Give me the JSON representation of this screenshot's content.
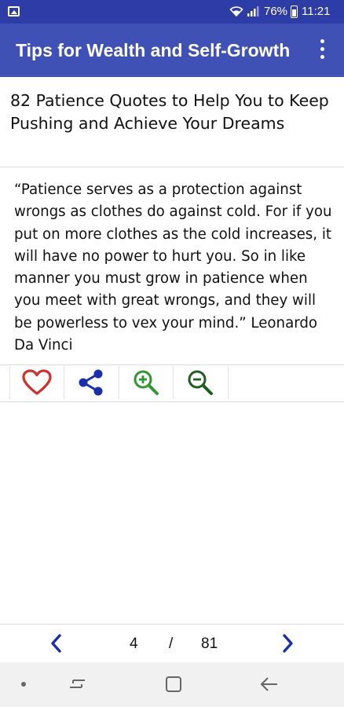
{
  "status_bar": {
    "battery_percent": "76%",
    "time": "11:21",
    "icons": [
      "gallery-icon",
      "wifi-icon",
      "signal-icon",
      "battery-icon"
    ]
  },
  "app_bar": {
    "title": "Tips for Wealth and Self-Growth",
    "menu_icon": "more-vert-icon",
    "background": "#3f51b5"
  },
  "article": {
    "title": "82 Patience Quotes to Help You to Keep Pushing and Achieve Your Dreams",
    "quote": "“Patience serves as a protection against wrongs as clothes do against cold. For if you put on more clothes as the cold increases, it will have no power to hurt you. So in like manner you must grow in patience when you meet with great wrongs, and they will be powerless to vex your mind.” Leonardo Da Vinci"
  },
  "actions": [
    {
      "icon": "heart-icon",
      "color": "#d32f2f"
    },
    {
      "icon": "share-icon",
      "color": "#1a2fb0"
    },
    {
      "icon": "zoom-in-icon",
      "color": "#2e9a2e"
    },
    {
      "icon": "zoom-out-icon",
      "color": "#1e5e1e"
    }
  ],
  "pager": {
    "current": "4",
    "separator": "/",
    "total": "81",
    "prev_icon": "chevron-left-icon",
    "next_icon": "chevron-right-icon",
    "arrow_color": "#1a2fb0"
  },
  "nav_bar": {
    "icons": [
      "dot-icon",
      "recent-apps-icon",
      "home-icon",
      "back-icon"
    ]
  }
}
